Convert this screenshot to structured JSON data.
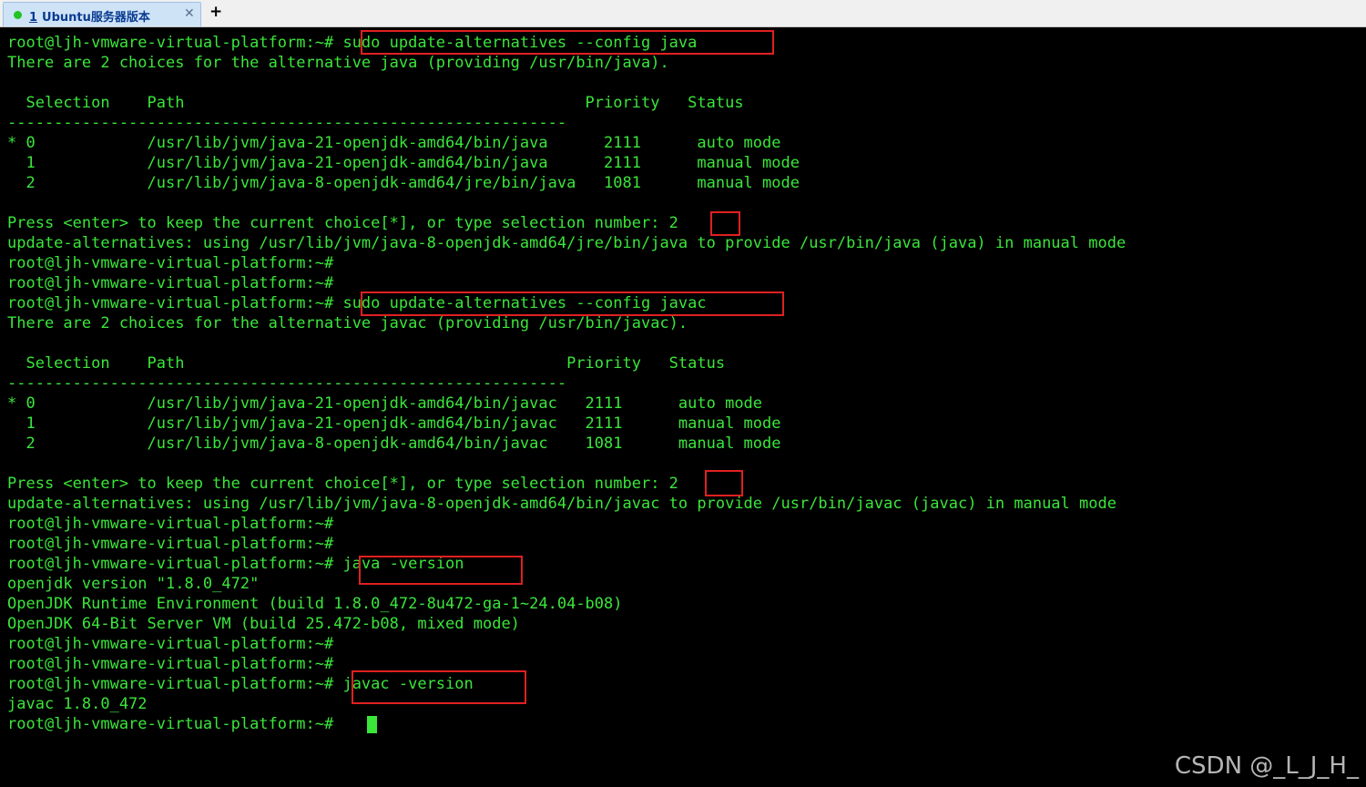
{
  "tab": {
    "number": "1",
    "title": "Ubuntu服务器版本",
    "close_glyph": "✕",
    "add_glyph": "+"
  },
  "terminal": {
    "lines": [
      "root@ljh-vmware-virtual-platform:~# sudo update-alternatives --config java",
      "There are 2 choices for the alternative java (providing /usr/bin/java).",
      "",
      "  Selection    Path                                           Priority   Status",
      "------------------------------------------------------------",
      "* 0            /usr/lib/jvm/java-21-openjdk-amd64/bin/java      2111      auto mode",
      "  1            /usr/lib/jvm/java-21-openjdk-amd64/bin/java      2111      manual mode",
      "  2            /usr/lib/jvm/java-8-openjdk-amd64/jre/bin/java   1081      manual mode",
      "",
      "Press <enter> to keep the current choice[*], or type selection number: 2",
      "update-alternatives: using /usr/lib/jvm/java-8-openjdk-amd64/jre/bin/java to provide /usr/bin/java (java) in manual mode",
      "root@ljh-vmware-virtual-platform:~#",
      "root@ljh-vmware-virtual-platform:~#",
      "root@ljh-vmware-virtual-platform:~# sudo update-alternatives --config javac",
      "There are 2 choices for the alternative javac (providing /usr/bin/javac).",
      "",
      "  Selection    Path                                         Priority   Status",
      "------------------------------------------------------------",
      "* 0            /usr/lib/jvm/java-21-openjdk-amd64/bin/javac   2111      auto mode",
      "  1            /usr/lib/jvm/java-21-openjdk-amd64/bin/javac   2111      manual mode",
      "  2            /usr/lib/jvm/java-8-openjdk-amd64/bin/javac    1081      manual mode",
      "",
      "Press <enter> to keep the current choice[*], or type selection number: 2",
      "update-alternatives: using /usr/lib/jvm/java-8-openjdk-amd64/bin/javac to provide /usr/bin/javac (javac) in manual mode",
      "root@ljh-vmware-virtual-platform:~#",
      "root@ljh-vmware-virtual-platform:~#",
      "root@ljh-vmware-virtual-platform:~# java -version",
      "openjdk version \"1.8.0_472\"",
      "OpenJDK Runtime Environment (build 1.8.0_472-8u472-ga-1~24.04-b08)",
      "OpenJDK 64-Bit Server VM (build 25.472-b08, mixed mode)",
      "root@ljh-vmware-virtual-platform:~#",
      "root@ljh-vmware-virtual-platform:~#",
      "root@ljh-vmware-virtual-platform:~# javac -version",
      "javac 1.8.0_472",
      "root@ljh-vmware-virtual-platform:~# "
    ]
  },
  "watermark": "CSDN @_L_J_H_",
  "colors": {
    "terminal_text": "#3ae63a",
    "terminal_bg": "#000000",
    "highlight_box": "#e02020",
    "tab_active_bg": "#cfe3f7",
    "status_dot": "#22c422"
  }
}
